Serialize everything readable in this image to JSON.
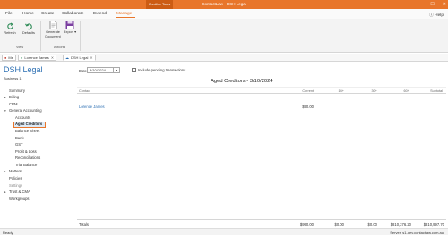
{
  "titlebar": {
    "context_tab": "Creditor Tools",
    "title": "ContactLaw - DSH Legal",
    "controls": [
      "—",
      "☐",
      "✕"
    ]
  },
  "menu": {
    "items": [
      "File",
      "Home",
      "Create",
      "Collaborate",
      "Extend",
      "Manage"
    ],
    "active": "Manage",
    "help": "Help"
  },
  "ribbon": {
    "view_buttons": [
      {
        "label": "Refresh",
        "icon": "refresh-icon"
      },
      {
        "label": "Defaults",
        "icon": "undo-icon"
      }
    ],
    "view_group": "View",
    "actions_buttons": [
      {
        "label": "Generate Document",
        "icon": "document-icon"
      },
      {
        "label": "Export",
        "icon": "save-icon"
      }
    ],
    "actions_group": "Actions"
  },
  "doctabs": [
    {
      "label": "Me",
      "icon": "user-icon"
    },
    {
      "label": "Lorence James",
      "icon": "person-icon"
    },
    {
      "label": "DSH Legal",
      "icon": "cloud-icon"
    }
  ],
  "sidebar": {
    "title": "DSH Legal",
    "business": "Business 1",
    "nav": {
      "summary": "Summary",
      "billing": "Billing",
      "crm": "CRM",
      "general_accounting": "General Accounting",
      "accounts": "Accounts",
      "aged_creditors": "Aged Creditors",
      "balance_sheet": "Balance Sheet",
      "bank": "Bank",
      "gst": "GST",
      "profit_loss": "Profit & Loss",
      "reconciliations": "Reconciliations",
      "trial_balance": "Trial Balance",
      "matters": "Matters",
      "policies": "Policies",
      "settings": "Settings",
      "trust_cma": "Trust & CMA",
      "workgroups": "Workgroups"
    }
  },
  "main": {
    "date_label": "Date",
    "date_value": "3/10/2024",
    "date_btn": "▾",
    "pending_label": "Include pending transactions",
    "report_title": "Aged Creditors - 3/10/2024",
    "columns": {
      "contact": "Contact",
      "current": "Current",
      "d14": "14+",
      "d30": "30+",
      "d60": "60+",
      "subtotal": "Subtotal"
    },
    "rows": [
      {
        "contact": "Lorence James",
        "current": "$90.00"
      }
    ],
    "totals": {
      "label": "Totals",
      "current": "$990.00",
      "d14": "$0.00",
      "d30": "$0.00",
      "d60": "$810,376.20",
      "subtotal": "$810,997.70"
    }
  },
  "status": {
    "left": "Ready",
    "right": "Server: s1-dev.contactlaw.com.au"
  },
  "colors": {
    "accent": "#e8762b",
    "link": "#2c6fb3"
  }
}
